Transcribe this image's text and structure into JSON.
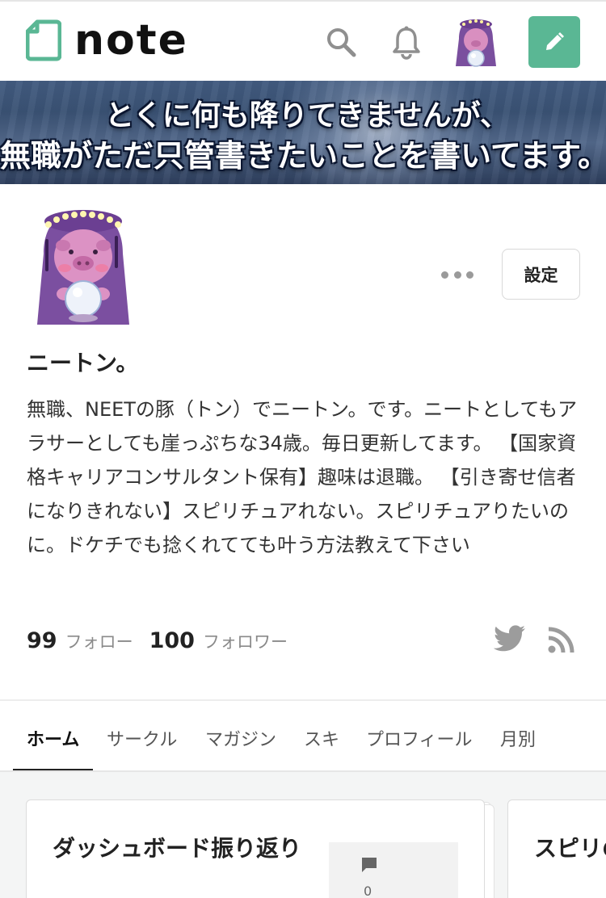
{
  "header": {
    "logo_text": "note",
    "brand_color": "#5ab794",
    "icons": [
      "search-icon",
      "bell-icon",
      "pencil-icon"
    ]
  },
  "banner": {
    "line1": "とくに何も降りてきませんが、",
    "line2": "無職がただ只管書きたいことを書いてます。"
  },
  "profile": {
    "name": "ニートン。",
    "settings_label": "設定",
    "bio": "無職、NEETの豚（トン）でニートン。です。ニートとしてもアラサーとしても崖っぷちな34歳。毎日更新してます。 【国家資格キャリアコンサルタント保有】趣味は退職。 【引き寄せ信者になりきれない】スピリチュアれない。スピリチュアりたいのに。ドケチでも捻くれてても叶う方法教えて下さい",
    "following_count": "99",
    "following_label": "フォロー",
    "followers_count": "100",
    "followers_label": "フォロワー"
  },
  "tabs": [
    {
      "label": "ホーム",
      "active": true
    },
    {
      "label": "サークル",
      "active": false
    },
    {
      "label": "マガジン",
      "active": false
    },
    {
      "label": "スキ",
      "active": false
    },
    {
      "label": "プロフィール",
      "active": false
    },
    {
      "label": "月別",
      "active": false
    }
  ],
  "cards": [
    {
      "title": "ダッシュボード振り返り",
      "comment_count": "0"
    },
    {
      "title": "スピリの引き"
    }
  ]
}
